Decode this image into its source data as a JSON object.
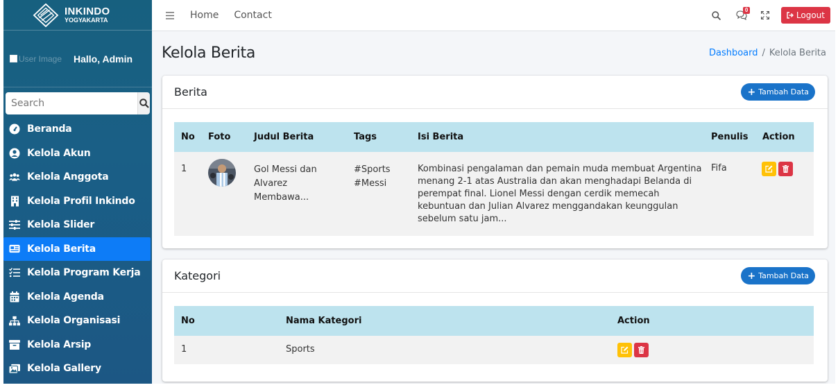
{
  "brand": {
    "title": "INKINDO",
    "subtitle": "YOGYAKARTA"
  },
  "user": {
    "image_alt": "User Image",
    "greeting": "Hallo,  Admin"
  },
  "search": {
    "placeholder": "Search"
  },
  "sidebar": {
    "items": [
      {
        "label": "Beranda",
        "icon": "tachometer-icon",
        "active": false
      },
      {
        "label": "Kelola Akun",
        "icon": "user-circle-icon",
        "active": false
      },
      {
        "label": "Kelola Anggota",
        "icon": "users-icon",
        "active": false
      },
      {
        "label": "Kelola Profil Inkindo",
        "icon": "building-icon",
        "active": false
      },
      {
        "label": "Kelola Slider",
        "icon": "sliders-icon",
        "active": false
      },
      {
        "label": "Kelola Berita",
        "icon": "newspaper-icon",
        "active": true
      },
      {
        "label": "Kelola Program Kerja",
        "icon": "list-check-icon",
        "active": false
      },
      {
        "label": "Kelola Agenda",
        "icon": "calendar-icon",
        "active": false
      },
      {
        "label": "Kelola Organisasi",
        "icon": "sitemap-icon",
        "active": false
      },
      {
        "label": "Kelola Arsip",
        "icon": "archive-icon",
        "active": false
      },
      {
        "label": "Kelola Gallery",
        "icon": "images-icon",
        "active": false
      }
    ]
  },
  "topbar": {
    "links": [
      "Home",
      "Contact"
    ],
    "notification_count": "0",
    "logout_label": "Logout"
  },
  "page": {
    "title": "Kelola Berita",
    "breadcrumb": {
      "home": "Dashboard",
      "current": "Kelola Berita"
    }
  },
  "berita": {
    "title": "Berita",
    "add_label": "Tambah Data",
    "columns": [
      "No",
      "Foto",
      "Judul Berita",
      "Tags",
      "Isi Berita",
      "Penulis",
      "Action"
    ],
    "rows": [
      {
        "no": "1",
        "judul": "Gol Messi dan Alvarez Membawa...",
        "tags": "#Sports #Messi",
        "isi": "Kombinasi pengalaman dan pemain muda membuat Argentina menang 2-1 atas Australia dan akan menghadapi Belanda di perempat final. Lionel Messi dengan cerdik memecah kebuntuan dan Julian Alvarez menggandakan keunggulan sebelum satu jam...",
        "penulis": "Fifa"
      }
    ]
  },
  "kategori": {
    "title": "Kategori",
    "add_label": "Tambah Data",
    "columns": [
      "No",
      "Nama Kategori",
      "Action"
    ],
    "rows": [
      {
        "no": "1",
        "nama": "Sports"
      }
    ]
  },
  "colors": {
    "sidebar": "#1a5f86",
    "active": "#0d7cf7",
    "edit": "#ffc107",
    "delete": "#dc3545",
    "table_head": "#bde3ee",
    "add_button": "#1a73c9"
  }
}
